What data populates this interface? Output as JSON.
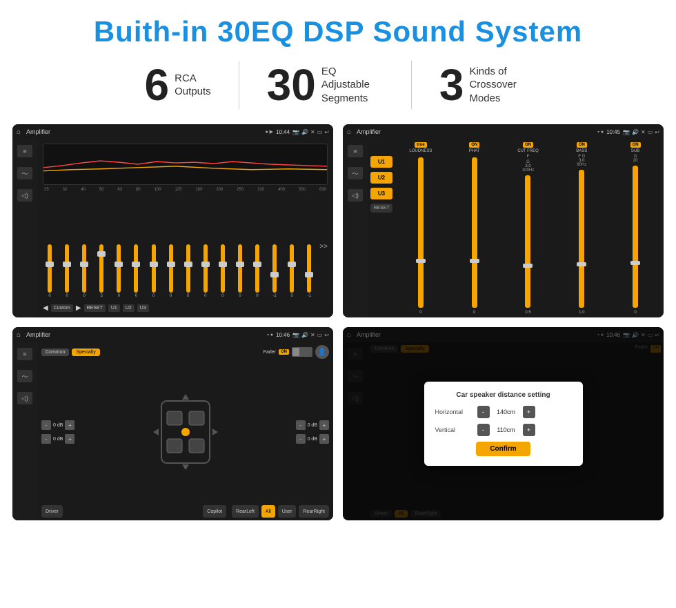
{
  "page": {
    "title": "Buith-in 30EQ DSP Sound System"
  },
  "stats": [
    {
      "number": "6",
      "text": "RCA\nOutputs"
    },
    {
      "number": "30",
      "text": "EQ Adjustable\nSegments"
    },
    {
      "number": "3",
      "text": "Kinds of\nCrossover Modes"
    }
  ],
  "cards": [
    {
      "id": "eq-screen",
      "topbar": {
        "title": "Amplifier",
        "time": "10:44"
      },
      "type": "eq"
    },
    {
      "id": "crossover-screen",
      "topbar": {
        "title": "Amplifier",
        "time": "10:45"
      },
      "type": "crossover"
    },
    {
      "id": "fader-screen",
      "topbar": {
        "title": "Amplifier",
        "time": "10:46"
      },
      "type": "fader"
    },
    {
      "id": "dialog-screen",
      "topbar": {
        "title": "Amplifier",
        "time": "10:46"
      },
      "type": "dialog"
    }
  ],
  "eq": {
    "freq_labels": [
      "25",
      "32",
      "40",
      "50",
      "63",
      "80",
      "100",
      "125",
      "160",
      "200",
      "250",
      "320",
      "400",
      "500",
      "630"
    ],
    "bottom_btns": [
      "Custom",
      "RESET",
      "U1",
      "U2",
      "U3"
    ],
    "slider_vals": [
      "0",
      "0",
      "0",
      "5",
      "0",
      "0",
      "0",
      "0",
      "0",
      "0",
      "0",
      "0",
      "0",
      "-1",
      "0",
      "-1"
    ]
  },
  "crossover": {
    "u_buttons": [
      "U1",
      "U2",
      "U3"
    ],
    "channels": [
      {
        "label": "LOUDNESS",
        "on": true
      },
      {
        "label": "PHAT",
        "on": true
      },
      {
        "label": "CUT FREQ",
        "on": true
      },
      {
        "label": "BASS",
        "on": true
      },
      {
        "label": "SUB",
        "on": true
      }
    ]
  },
  "fader": {
    "tabs": [
      "Common",
      "Specialty"
    ],
    "active_tab": "Specialty",
    "fader_label": "Fader",
    "fader_on": true,
    "db_values": [
      "0 dB",
      "0 dB",
      "0 dB",
      "0 dB"
    ],
    "bottom_btns": [
      "Driver",
      "Copilot",
      "RearLeft",
      "All",
      "User",
      "RearRight"
    ],
    "active_bottom": "All"
  },
  "dialog": {
    "title": "Car speaker distance setting",
    "horizontal_label": "Horizontal",
    "horizontal_value": "140cm",
    "vertical_label": "Vertical",
    "vertical_value": "110cm",
    "confirm_label": "Confirm"
  }
}
